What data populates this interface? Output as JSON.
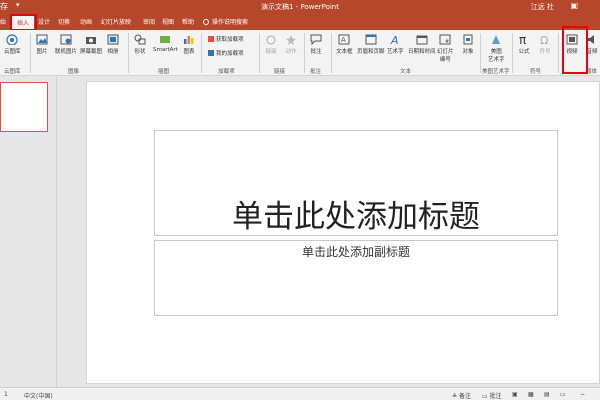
{
  "titlebar": {
    "app_title": "演示文稿1 - PowerPoint",
    "user": "江远 杜",
    "left_fragment": "存"
  },
  "tabs": [
    {
      "label": "始",
      "name": "tab-home"
    },
    {
      "label": "插入",
      "name": "tab-insert",
      "active": true
    },
    {
      "label": "设计",
      "name": "tab-design"
    },
    {
      "label": "切换",
      "name": "tab-transitions"
    },
    {
      "label": "动画",
      "name": "tab-animations"
    },
    {
      "label": "幻灯片放映",
      "name": "tab-slideshow"
    },
    {
      "label": "审阅",
      "name": "tab-review"
    },
    {
      "label": "视图",
      "name": "tab-view"
    },
    {
      "label": "帮助",
      "name": "tab-help"
    }
  ],
  "tellme": "操作说明搜索",
  "ribbon": {
    "buttons": {
      "cloud_lib": "云图库",
      "picture": "图片",
      "online_picture": "联机图片",
      "screenshot": "屏幕截图",
      "album": "相册",
      "shapes": "形状",
      "smartart": "SmartArt",
      "chart": "图表",
      "get_addins": "获取加载项",
      "my_addins": "我的加载项",
      "link": "链接",
      "action": "动作",
      "comment": "批注",
      "textbox": "文本框",
      "header_footer": "页眉和页脚",
      "wordart": "艺术字",
      "datetime": "日期和时间",
      "slide_number_1": "幻灯片",
      "slide_number_2": "编号",
      "object": "对象",
      "art_text_1": "美图",
      "art_text_2": "艺术字",
      "equation": "公式",
      "symbol": "符号",
      "video": "视频",
      "audio_fragment": "音频"
    },
    "groups": {
      "cloud": "云图库",
      "images": "图像",
      "illustrations": "插图",
      "addins": "加载项",
      "links": "链接",
      "comments": "批注",
      "text": "文本",
      "art": "美图艺术字",
      "symbols": "符号",
      "media_fragment": "媒体"
    }
  },
  "slide": {
    "title_placeholder": "单击此处添加标题",
    "subtitle_placeholder": "单击此处添加副标题"
  },
  "statusbar": {
    "slide_info": "1",
    "language": "中文(中国)",
    "notes": "备注",
    "comments": "批注"
  },
  "colors": {
    "accent": "#b7472a",
    "highlight": "#e60012"
  }
}
